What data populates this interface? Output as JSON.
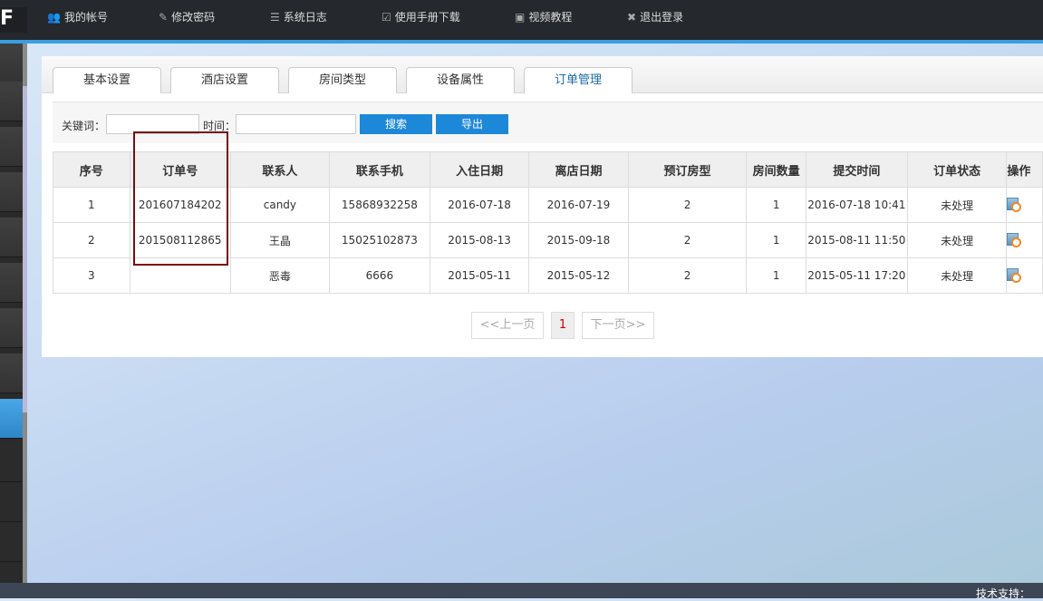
{
  "topnav": [
    {
      "icon": "user-icon",
      "glyph": "👥",
      "label": "我的帐号"
    },
    {
      "icon": "edit-icon",
      "glyph": "✎",
      "label": "修改密码"
    },
    {
      "icon": "list-icon",
      "glyph": "☰",
      "label": "系统日志"
    },
    {
      "icon": "checkbox-icon",
      "glyph": "☑",
      "label": "使用手册下载"
    },
    {
      "icon": "calendar-icon",
      "glyph": "▣",
      "label": "视频教程"
    },
    {
      "icon": "close-icon",
      "glyph": "✖",
      "label": "退出登录"
    }
  ],
  "tabs": [
    "基本设置",
    "酒店设置",
    "房间类型",
    "设备属性",
    "订单管理"
  ],
  "active_tab": "订单管理",
  "search": {
    "keyword_label": "关键词：",
    "keyword_value": "",
    "time_label": "时间：",
    "time_value": "",
    "search_button": "搜索",
    "export_button": "导出"
  },
  "table": {
    "headers": [
      "序号",
      "订单号",
      "联系人",
      "联系手机",
      "入住日期",
      "离店日期",
      "预订房型",
      "房间数量",
      "提交时间",
      "订单状态",
      "操作"
    ],
    "rows": [
      [
        "1",
        "201607184202",
        "candy",
        "15868932258",
        "2016-07-18",
        "2016-07-19",
        "2",
        "1",
        "2016-07-18 10:41",
        "未处理"
      ],
      [
        "2",
        "201508112865",
        "王晶",
        "15025102873",
        "2015-08-13",
        "2015-09-18",
        "2",
        "1",
        "2015-08-11 11:50",
        "未处理"
      ],
      [
        "3",
        "",
        "恶毒",
        "6666",
        "2015-05-11",
        "2015-05-12",
        "2",
        "1",
        "2015-05-11 17:20",
        "未处理"
      ]
    ]
  },
  "pagination": {
    "prev": "<<上一页",
    "current": "1",
    "next": "下一页>>"
  },
  "footer": "技术支持：",
  "colors": {
    "accent": "#1e88d8",
    "highlight_box": "#7a0d0d"
  }
}
